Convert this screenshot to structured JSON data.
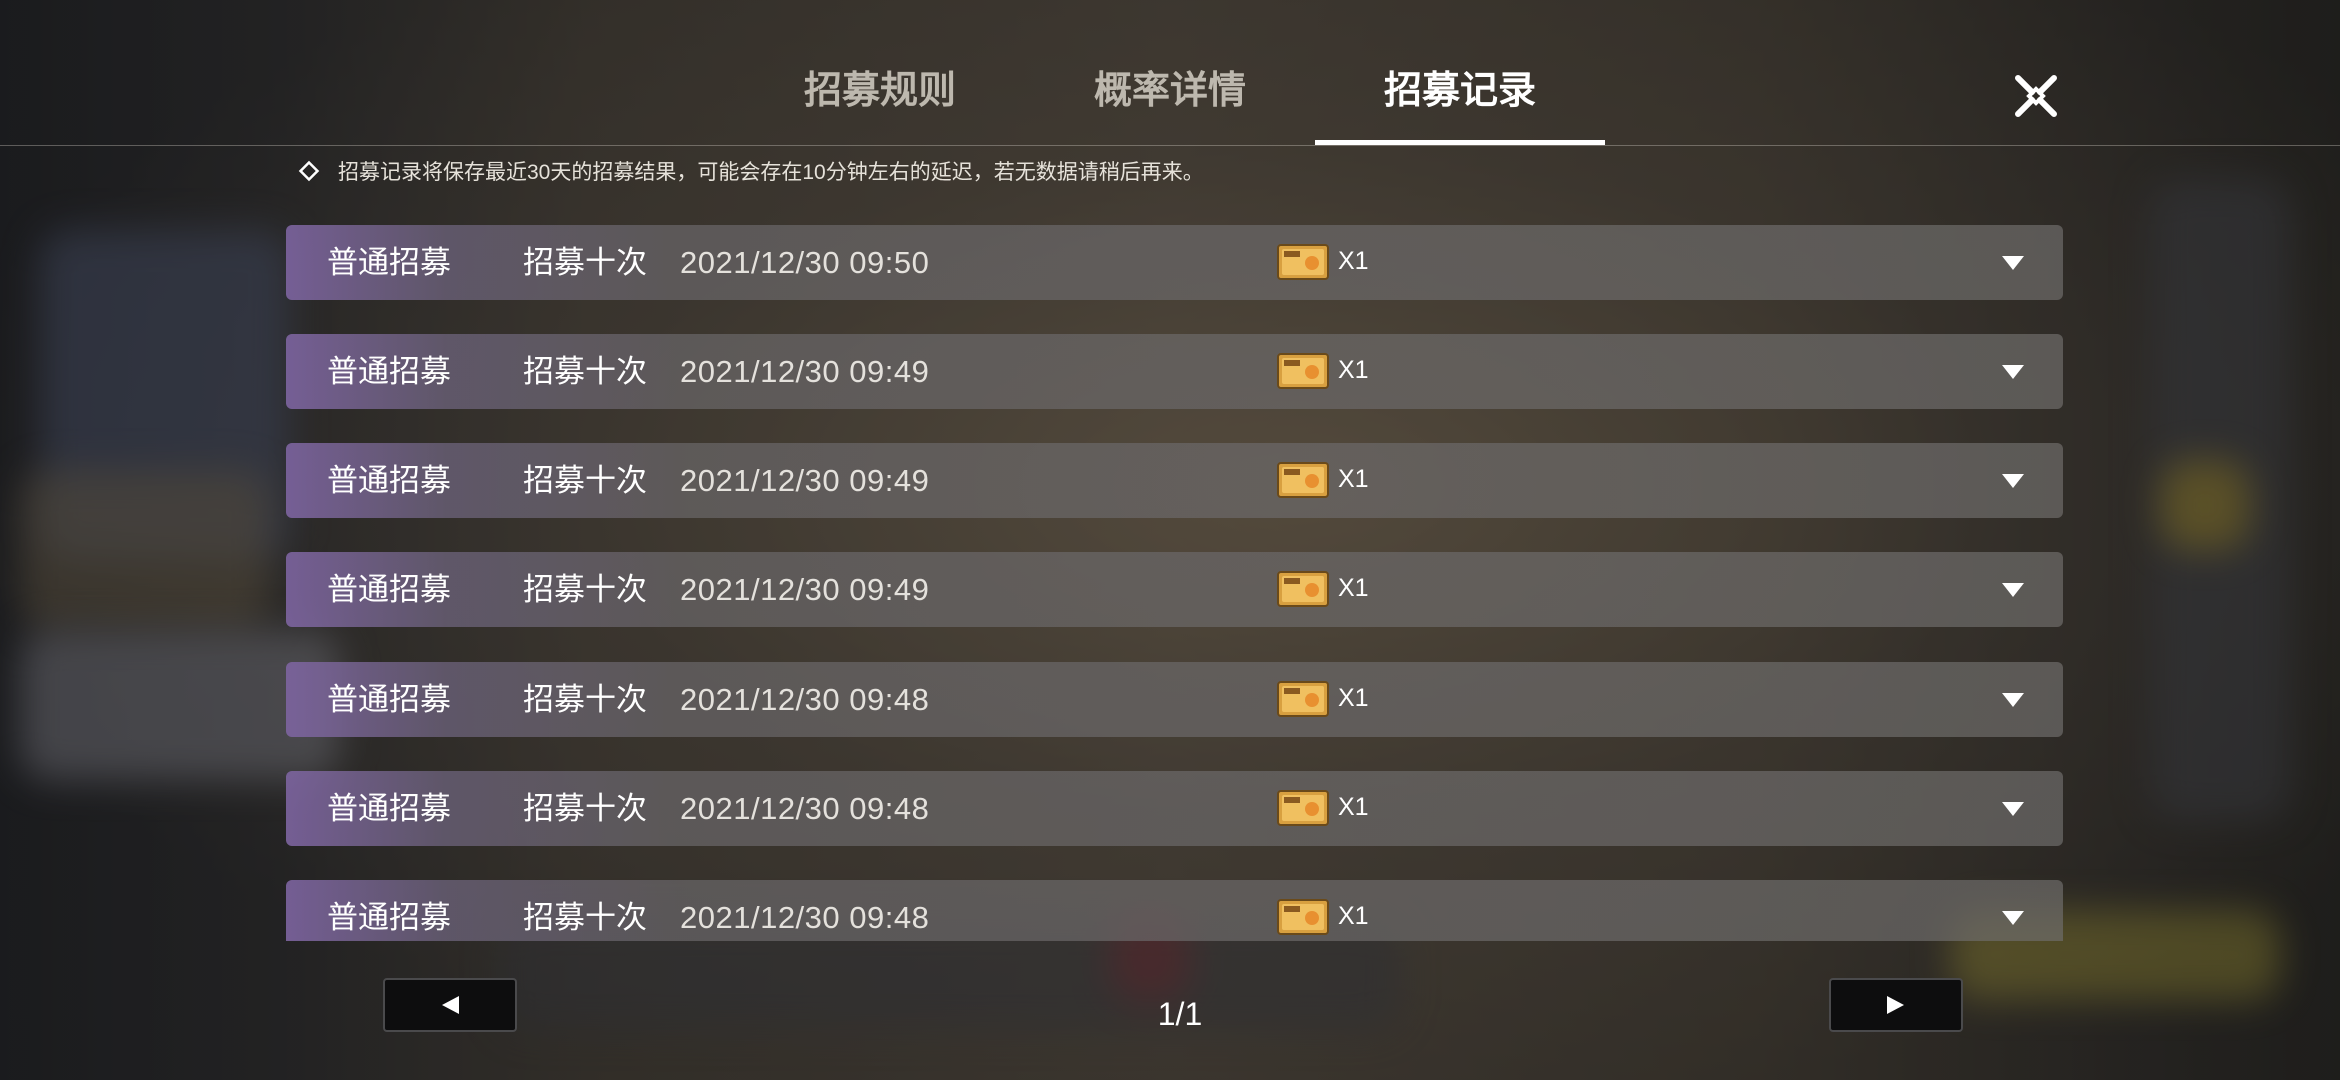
{
  "tabs": [
    {
      "label": "招募规则",
      "active": false
    },
    {
      "label": "概率详情",
      "active": false
    },
    {
      "label": "招募记录",
      "active": true
    }
  ],
  "notice": "招募记录将保存最近30天的招募结果，可能会存在10分钟左右的延迟，若无数据请稍后再来。",
  "records": [
    {
      "type": "普通招募",
      "count": "招募十次",
      "time": "2021/12/30 09:50",
      "qty": "X1"
    },
    {
      "type": "普通招募",
      "count": "招募十次",
      "time": "2021/12/30 09:49",
      "qty": "X1"
    },
    {
      "type": "普通招募",
      "count": "招募十次",
      "time": "2021/12/30 09:49",
      "qty": "X1"
    },
    {
      "type": "普通招募",
      "count": "招募十次",
      "time": "2021/12/30 09:49",
      "qty": "X1"
    },
    {
      "type": "普通招募",
      "count": "招募十次",
      "time": "2021/12/30 09:48",
      "qty": "X1"
    },
    {
      "type": "普通招募",
      "count": "招募十次",
      "time": "2021/12/30 09:48",
      "qty": "X1"
    },
    {
      "type": "普通招募",
      "count": "招募十次",
      "time": "2021/12/30 09:48",
      "qty": "X1"
    }
  ],
  "pagination": {
    "label": "1/1"
  },
  "icons": {
    "close": "close-icon",
    "notice": "diamond-icon",
    "ticket": "recruit-ticket-icon",
    "expand": "chevron-down-icon",
    "prev": "triangle-left-icon",
    "next": "triangle-right-icon"
  },
  "colors": {
    "row_accent": "#7d64a0",
    "tab_active": "#ffffff",
    "tab_inactive": "#bdb8ae"
  }
}
